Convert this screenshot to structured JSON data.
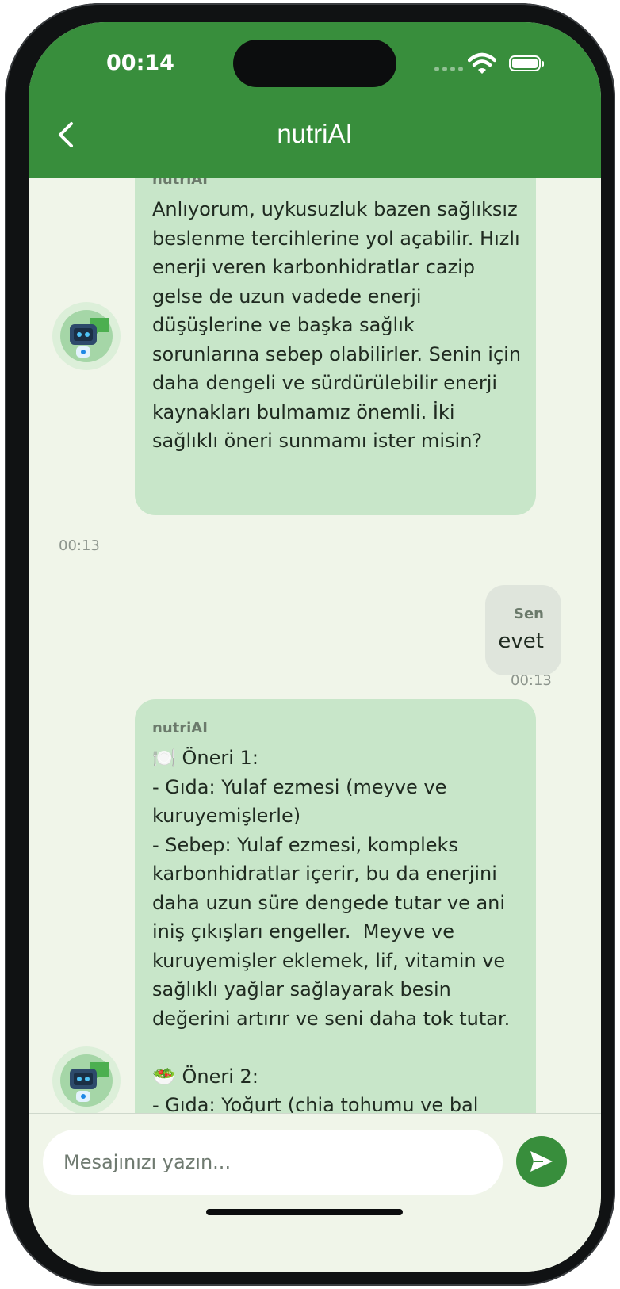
{
  "status_bar": {
    "time": "00:14"
  },
  "header": {
    "title": "nutriAI"
  },
  "messages": [
    {
      "sender": "nutriAI",
      "text": "Anlıyorum, uykusuzluk bazen sağlıksız beslenme tercihlerine yol açabilir. Hızlı enerji veren karbonhidratlar cazip gelse de uzun vadede enerji düşüşlerine ve başka sağlık sorunlarına sebep olabilirler. Senin için daha dengeli ve sürdürülebilir enerji kaynakları bulmamız önemli. İki sağlıklı öneri sunmamı ister misin?",
      "time": "00:13"
    },
    {
      "sender": "Sen",
      "text": "evet",
      "time": "00:13"
    },
    {
      "sender": "nutriAI",
      "text": "🍽️ Öneri 1:\n- Gıda: Yulaf ezmesi (meyve ve kuruyemişlerle)\n- Sebep: Yulaf ezmesi, kompleks karbonhidratlar içerir, bu da enerjini daha uzun süre dengede tutar ve ani iniş çıkışları engeller.  Meyve ve kuruyemişler eklemek, lif, vitamin ve sağlıklı yağlar sağlayarak besin değerini artırır ve seni daha tok tutar.\n\n🥗 Öneri 2:\n- Gıda: Yoğurt (chia tohumu ve bal"
    }
  ],
  "composer": {
    "placeholder": "Mesajınızı yazın..."
  },
  "colors": {
    "primary": "#388e3c",
    "bot_bubble": "#c8e6c9",
    "user_bubble": "#dfe5dc",
    "background": "#f0f5e9"
  },
  "icons": [
    "back-icon",
    "wifi-icon",
    "battery-icon",
    "robot-avatar-icon",
    "send-icon"
  ]
}
